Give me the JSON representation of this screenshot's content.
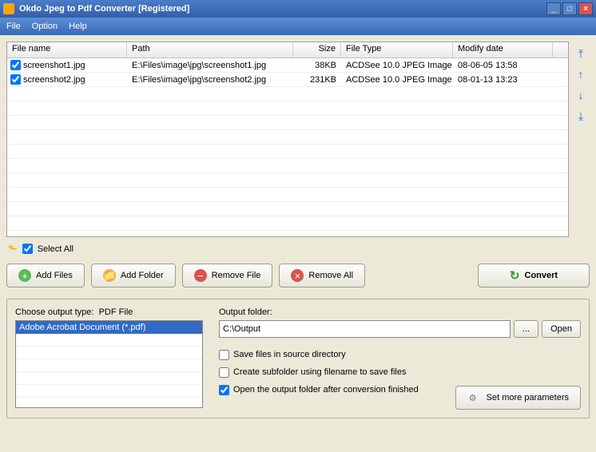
{
  "window": {
    "title": "Okdo Jpeg to Pdf Converter [Registered]"
  },
  "menu": {
    "file": "File",
    "option": "Option",
    "help": "Help"
  },
  "table": {
    "headers": {
      "name": "File name",
      "path": "Path",
      "size": "Size",
      "type": "File Type",
      "mod": "Modify date"
    },
    "rows": [
      {
        "name": "screenshot1.jpg",
        "path": "E:\\Files\\image\\jpg\\screenshot1.jpg",
        "size": "38KB",
        "type": "ACDSee 10.0 JPEG Image",
        "mod": "08-06-05 13:58"
      },
      {
        "name": "screenshot2.jpg",
        "path": "E:\\Files\\image\\jpg\\screenshot2.jpg",
        "size": "231KB",
        "type": "ACDSee 10.0 JPEG Image",
        "mod": "08-01-13 13:23"
      }
    ]
  },
  "select_all": "Select All",
  "buttons": {
    "add_files": "Add Files",
    "add_folder": "Add Folder",
    "remove_file": "Remove File",
    "remove_all": "Remove All",
    "convert": "Convert",
    "browse": "...",
    "open": "Open",
    "set_more": "Set more parameters"
  },
  "output_type": {
    "label_prefix": "Choose output type:",
    "label_value": "PDF File",
    "option": "Adobe Acrobat Document (*.pdf)"
  },
  "output_folder": {
    "label": "Output folder:",
    "value": "C:\\Output"
  },
  "checks": {
    "save_source": "Save files in source directory",
    "create_sub": "Create subfolder using filename to save files",
    "open_after": "Open the output folder after conversion finished"
  }
}
